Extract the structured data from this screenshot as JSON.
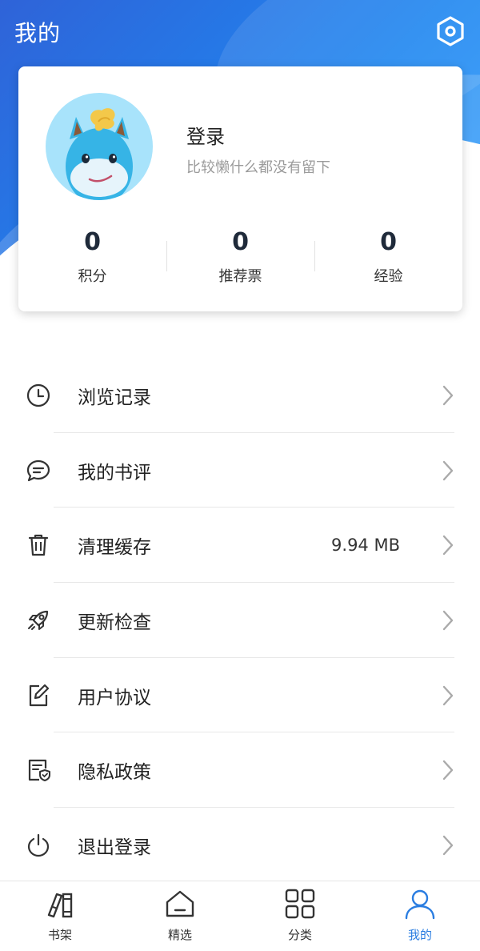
{
  "header": {
    "title": "我的"
  },
  "profile": {
    "login_label": "登录",
    "bio": "比较懒什么都没有留下",
    "stats": [
      {
        "value": "0",
        "label": "积分"
      },
      {
        "value": "0",
        "label": "推荐票"
      },
      {
        "value": "0",
        "label": "经验"
      }
    ]
  },
  "menu": {
    "items": [
      {
        "label": "浏览记录",
        "icon": "clock-icon"
      },
      {
        "label": "我的书评",
        "icon": "comment-icon"
      },
      {
        "label": "清理缓存",
        "icon": "trash-icon",
        "value": "9.94 MB"
      },
      {
        "label": "更新检查",
        "icon": "rocket-icon"
      },
      {
        "label": "用户协议",
        "icon": "edit-document-icon"
      },
      {
        "label": "隐私政策",
        "icon": "privacy-shield-icon"
      },
      {
        "label": "退出登录",
        "icon": "power-icon"
      }
    ]
  },
  "tabbar": {
    "items": [
      {
        "label": "书架",
        "icon": "bookshelf-icon",
        "active": false
      },
      {
        "label": "精选",
        "icon": "home-icon",
        "active": false
      },
      {
        "label": "分类",
        "icon": "grid-icon",
        "active": false
      },
      {
        "label": "我的",
        "icon": "user-icon",
        "active": true
      }
    ]
  },
  "colors": {
    "accent": "#2a7de1",
    "header_blue": "#1f86f0"
  }
}
